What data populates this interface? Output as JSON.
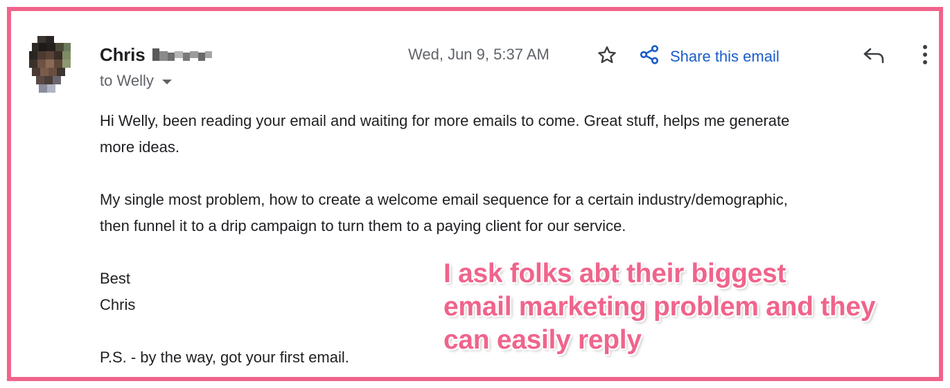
{
  "colors": {
    "frame": "#f0648c",
    "annotation": "#f0648c",
    "link": "#1a5dc9",
    "text": "#202124",
    "secondary": "#5f6368"
  },
  "header": {
    "sender_name": "Chris",
    "recipient": "to Welly",
    "date": "Wed, Jun 9, 5:37 AM",
    "share_label": "Share this email",
    "icons": [
      "star-icon",
      "share-icon",
      "reply-icon",
      "more-vert-icon",
      "chevron-down-icon"
    ]
  },
  "message": {
    "line1": "Hi Welly, been reading your email and waiting for more emails to come. Great stuff, helps me generate",
    "line2": "more ideas.",
    "line3": "My single most problem, how to create a welcome email sequence for a certain industry/demographic,",
    "line4": "then funnel it to a drip campaign to turn them to a paying client for our service.",
    "signoff": "Best",
    "signature": "Chris",
    "ps": "P.S. - by the way, got your first email."
  },
  "annotation": {
    "line1": "I ask folks abt their biggest",
    "line2": "email marketing problem and they",
    "line3": "can easily reply"
  }
}
